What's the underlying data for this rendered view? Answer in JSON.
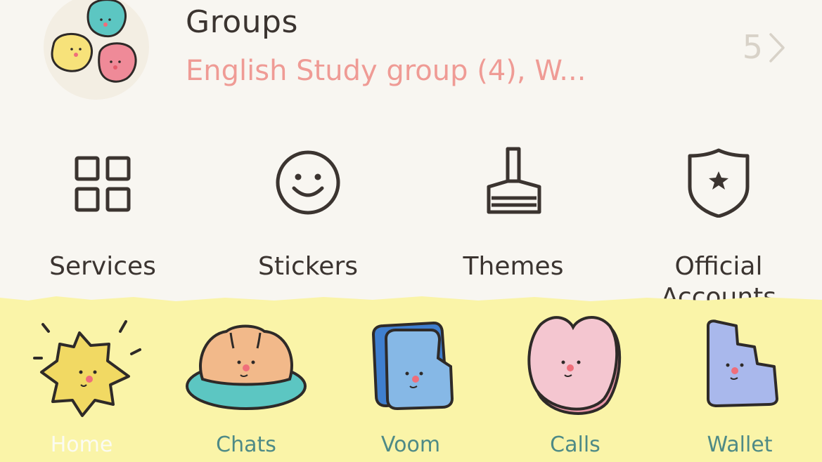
{
  "groups": {
    "title": "Groups",
    "subtitle": "English Study group (4), W...",
    "count": "5"
  },
  "shortcuts": [
    {
      "label": "Services",
      "icon": "grid-icon"
    },
    {
      "label": "Stickers",
      "icon": "smiley-icon"
    },
    {
      "label": "Themes",
      "icon": "paint-brush-icon"
    },
    {
      "label": "Official Accounts",
      "icon": "shield-star-icon"
    }
  ],
  "tabs": [
    {
      "label": "Home",
      "icon": "home-star-icon",
      "active": true
    },
    {
      "label": "Chats",
      "icon": "chats-bread-icon",
      "active": false
    },
    {
      "label": "Voom",
      "icon": "voom-icon",
      "active": false
    },
    {
      "label": "Calls",
      "icon": "calls-heart-icon",
      "active": false
    },
    {
      "label": "Wallet",
      "icon": "wallet-icon",
      "active": false
    }
  ],
  "colors": {
    "background": "#f8f6f1",
    "tabbar": "#faf4a8",
    "accent_pink": "#ef9b95",
    "tab_label": "#4e8a86",
    "active_label": "#fbfbf2"
  }
}
